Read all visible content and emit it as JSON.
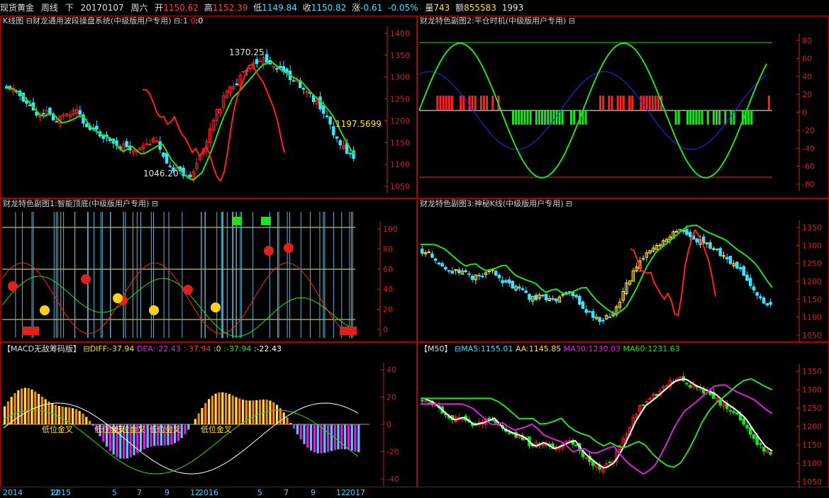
{
  "header": {
    "symbol": "现货黄金",
    "period": "周线",
    "nav": "下",
    "date": "20170107",
    "weekday": "周六",
    "open_label": "开",
    "open": "1150.62",
    "high_label": "高",
    "high": "1152.39",
    "low_label": "低",
    "low": "1149.84",
    "close_label": "收",
    "close": "1150.82",
    "change_label": "涨",
    "change": "-0.61",
    "change_pct": "-0.05%",
    "volume_label": "量",
    "volume": "743",
    "amount_label": "额",
    "amount": "855583",
    "extra": "1993"
  },
  "colors": {
    "up": "#ff2020",
    "down": "#40e0ff",
    "green": "#20e020",
    "yellow": "#ffe040",
    "magenta": "#e020e0",
    "axis": "#d02020"
  },
  "panels": {
    "kline": {
      "title": "K线图 ⊟财龙通用波段操盘系统(中级版用户专用)",
      "extras": [
        "⊟:1",
        ":0",
        ":0"
      ],
      "labels": {
        "peak": "1370.25",
        "trough": "1046.20",
        "last": "1197.5699"
      }
    },
    "sub2": {
      "title": "财龙特色副图2:平仓时机(中级版用户专用) ⊟"
    },
    "sub1": {
      "title": "财龙特色副图1:智能顶底(中级版用户专用) ⊟"
    },
    "sub3": {
      "title": "财龙特色副图3:神秘K线(中级版用户专用) ⊟"
    },
    "macd": {
      "name": "【MACD无敌筹码版】",
      "diff": "⊟DIFF:-37.94",
      "dea": "DEA:-22.43",
      "v1": ":-37.94",
      "v2": ":0",
      "v3": ":-37.94",
      "v4": ":-22.43",
      "tags": [
        "低位金叉",
        "低位金叉",
        "低位金叉",
        "低位金叉",
        "低位金叉"
      ]
    },
    "ma": {
      "name": "【M50】",
      "ma5": "⊟MA5:1155.01",
      "aa": "AA:1145.85",
      "ma30": "MA30:1230.03",
      "ma60": "MA60:1231.63"
    }
  },
  "axes": {
    "price": [
      "1400",
      "1350",
      "1300",
      "1250",
      "1200",
      "1150",
      "1100",
      "1050"
    ],
    "osc80": [
      "80",
      "60",
      "40",
      "20",
      "0",
      "-20",
      "-40",
      "-60",
      "-80"
    ],
    "osc100": [
      "100",
      "80",
      "60",
      "40",
      "20",
      "0"
    ],
    "price2": [
      "1350",
      "1300",
      "1250",
      "1200",
      "1150",
      "1100",
      "1050"
    ],
    "macd": [
      "40",
      "20",
      "0",
      "-20",
      "-40"
    ],
    "price3": [
      "1350",
      "1300",
      "1250",
      "1200",
      "1150",
      "1100",
      "1050"
    ]
  },
  "xaxis": [
    "2014",
    "12",
    "2015",
    "5",
    "7",
    "9",
    "12",
    "2016",
    "5",
    "7",
    "9",
    "12",
    "2017"
  ]
}
